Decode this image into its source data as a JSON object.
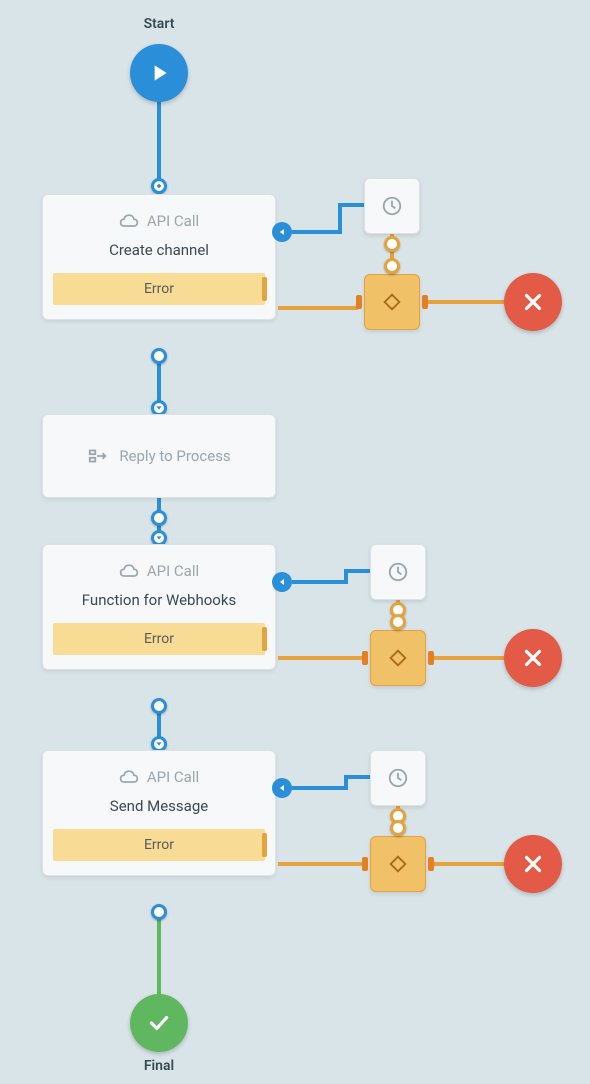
{
  "start_label": "Start",
  "final_label": "Final",
  "nodes": {
    "start": {
      "type": "start"
    },
    "api1": {
      "type_label": "API Call",
      "title": "Create channel",
      "error_label": "Error"
    },
    "reply": {
      "label": "Reply to Process"
    },
    "api2": {
      "type_label": "API Call",
      "title": "Function for Webhooks",
      "error_label": "Error"
    },
    "api3": {
      "type_label": "API Call",
      "title": "Send Message",
      "error_label": "Error"
    },
    "final": {
      "type": "final"
    }
  },
  "side_nodes": {
    "delay": {
      "icon": "clock-icon"
    },
    "condition": {
      "icon": "diamond-icon"
    },
    "error": {
      "icon": "close-icon"
    }
  },
  "colors": {
    "blue": "#2a8fd8",
    "orange": "#e6a23c",
    "red": "#e35a47",
    "green": "#5fb85f",
    "bg": "#d8e4e8"
  }
}
